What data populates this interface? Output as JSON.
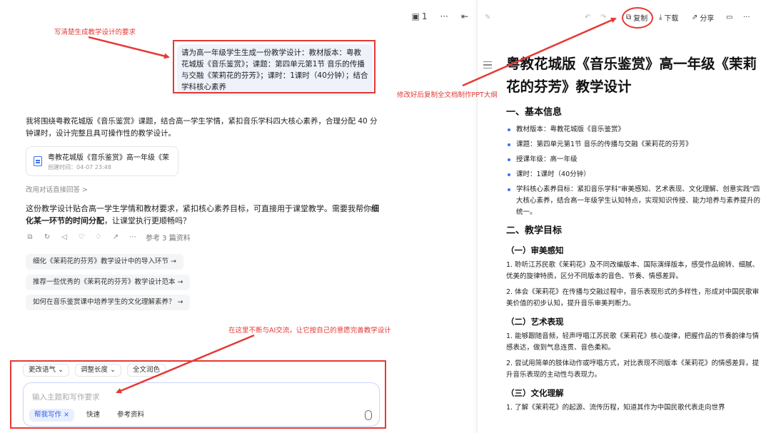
{
  "left_top": {
    "page_indicator": "1",
    "more": "···",
    "collapse": "⇤"
  },
  "prompt_bubble": "请为高一年级学生生成一份教学设计：教材版本：粤教花城版《音乐鉴赏》；课题：第四单元第1节 音乐的传播与交融《茉莉花的芬芳》；课时：1课时（40分钟）；结合学科核心素养",
  "reply_intro": "我将围绕粤教花城版《音乐鉴赏》课题，结合高一学生学情，紧扣音乐学科四大核心素养，合理分配 40 分钟课时，设计完整且具可操作性的教学设计。",
  "doc_card": {
    "title": "粤教花城版《音乐鉴赏》高一年级《茉莉…",
    "time": "创建时间：04-07 23:48"
  },
  "alt_answer": "改用对话直接回答  >",
  "reply_followup": {
    "pre": "这份教学设计贴合高一学生学情和教材要求，紧扣核心素养目标，可直接用于课堂教学。需要我帮你",
    "bold": "细化某一环节的时间分配",
    "post": "，让课堂执行更顺畅吗？"
  },
  "actions": {
    "reference": "参考 3 篇资料"
  },
  "suggestions": [
    "细化《茉莉花的芬芳》教学设计中的导入环节 →",
    "推荐一些优秀的《茉莉花的芬芳》教学设计范本 →",
    "如何在音乐鉴赏课中培养学生的文化理解素养？ →"
  ],
  "composer": {
    "tools": [
      "更改语气 ⌄",
      "调整长度 ⌄",
      "全文润色"
    ],
    "placeholder": "输入主题和写作要求",
    "chips": [
      "帮我写作 ×",
      "快速",
      "参考资料"
    ]
  },
  "right_toolbar": {
    "copy": "复制",
    "download": "下载",
    "share": "分享",
    "comment": "",
    "more": "···"
  },
  "document": {
    "title": "粤教花城版《音乐鉴赏》高一年级《茉莉花的芬芳》教学设计",
    "section1": "一、基本信息",
    "basic_info": [
      "教材版本：粤教花城版《音乐鉴赏》",
      "课题：第四单元第1节 音乐的传播与交融《茉莉花的芬芳》",
      "授课年级：高一年级",
      "课时：1课时（40分钟）",
      "学科核心素养目标：紧扣音乐学科\"审美感知、艺术表现、文化理解、创意实践\"四大核心素养，结合高一年级学生认知特点，实现知识传授、能力培养与素养提升的统一。"
    ],
    "section2": "二、教学目标",
    "sub1": "（一）审美感知",
    "sub1_p1": "1. 聆听江苏民歌《茉莉花》及不同改编版本、国际演绎版本，感受作品婉转、细腻、优美的旋律特质，区分不同版本的音色、节奏、情感差异。",
    "sub1_p2": "2. 体会《茉莉花》在传播与交融过程中，音乐表现形式的多样性，形成对中国民歌审美价值的初步认知，提升音乐审美判断力。",
    "sub2": "（二）艺术表现",
    "sub2_p1": "1. 能够跟随音频，轻声哼唱江苏民歌《茉莉花》核心旋律，把握作品的节奏韵律与情感表达，做到气息连贯、音色柔和。",
    "sub2_p2": "2. 尝试用简单的肢体动作或哼唱方式，对比表现不同版本《茉莉花》的情感差异，提升音乐表现的主动性与表现力。",
    "sub3": "（三）文化理解",
    "sub3_p1": "1. 了解《茉莉花》的起源、流传历程，知道其作为中国民歌代表走向世界"
  },
  "annotations": {
    "top": "写清楚生成教学设计的要求",
    "right": "修改好后复制全文档制作PPT大纲",
    "bottom": "在这里不断与AI交流，让它按自己的意愿完善教学设计"
  },
  "colors": {
    "annotation": "#e53935",
    "accent": "#3a6ff0",
    "bubble": "#eef2fb"
  }
}
